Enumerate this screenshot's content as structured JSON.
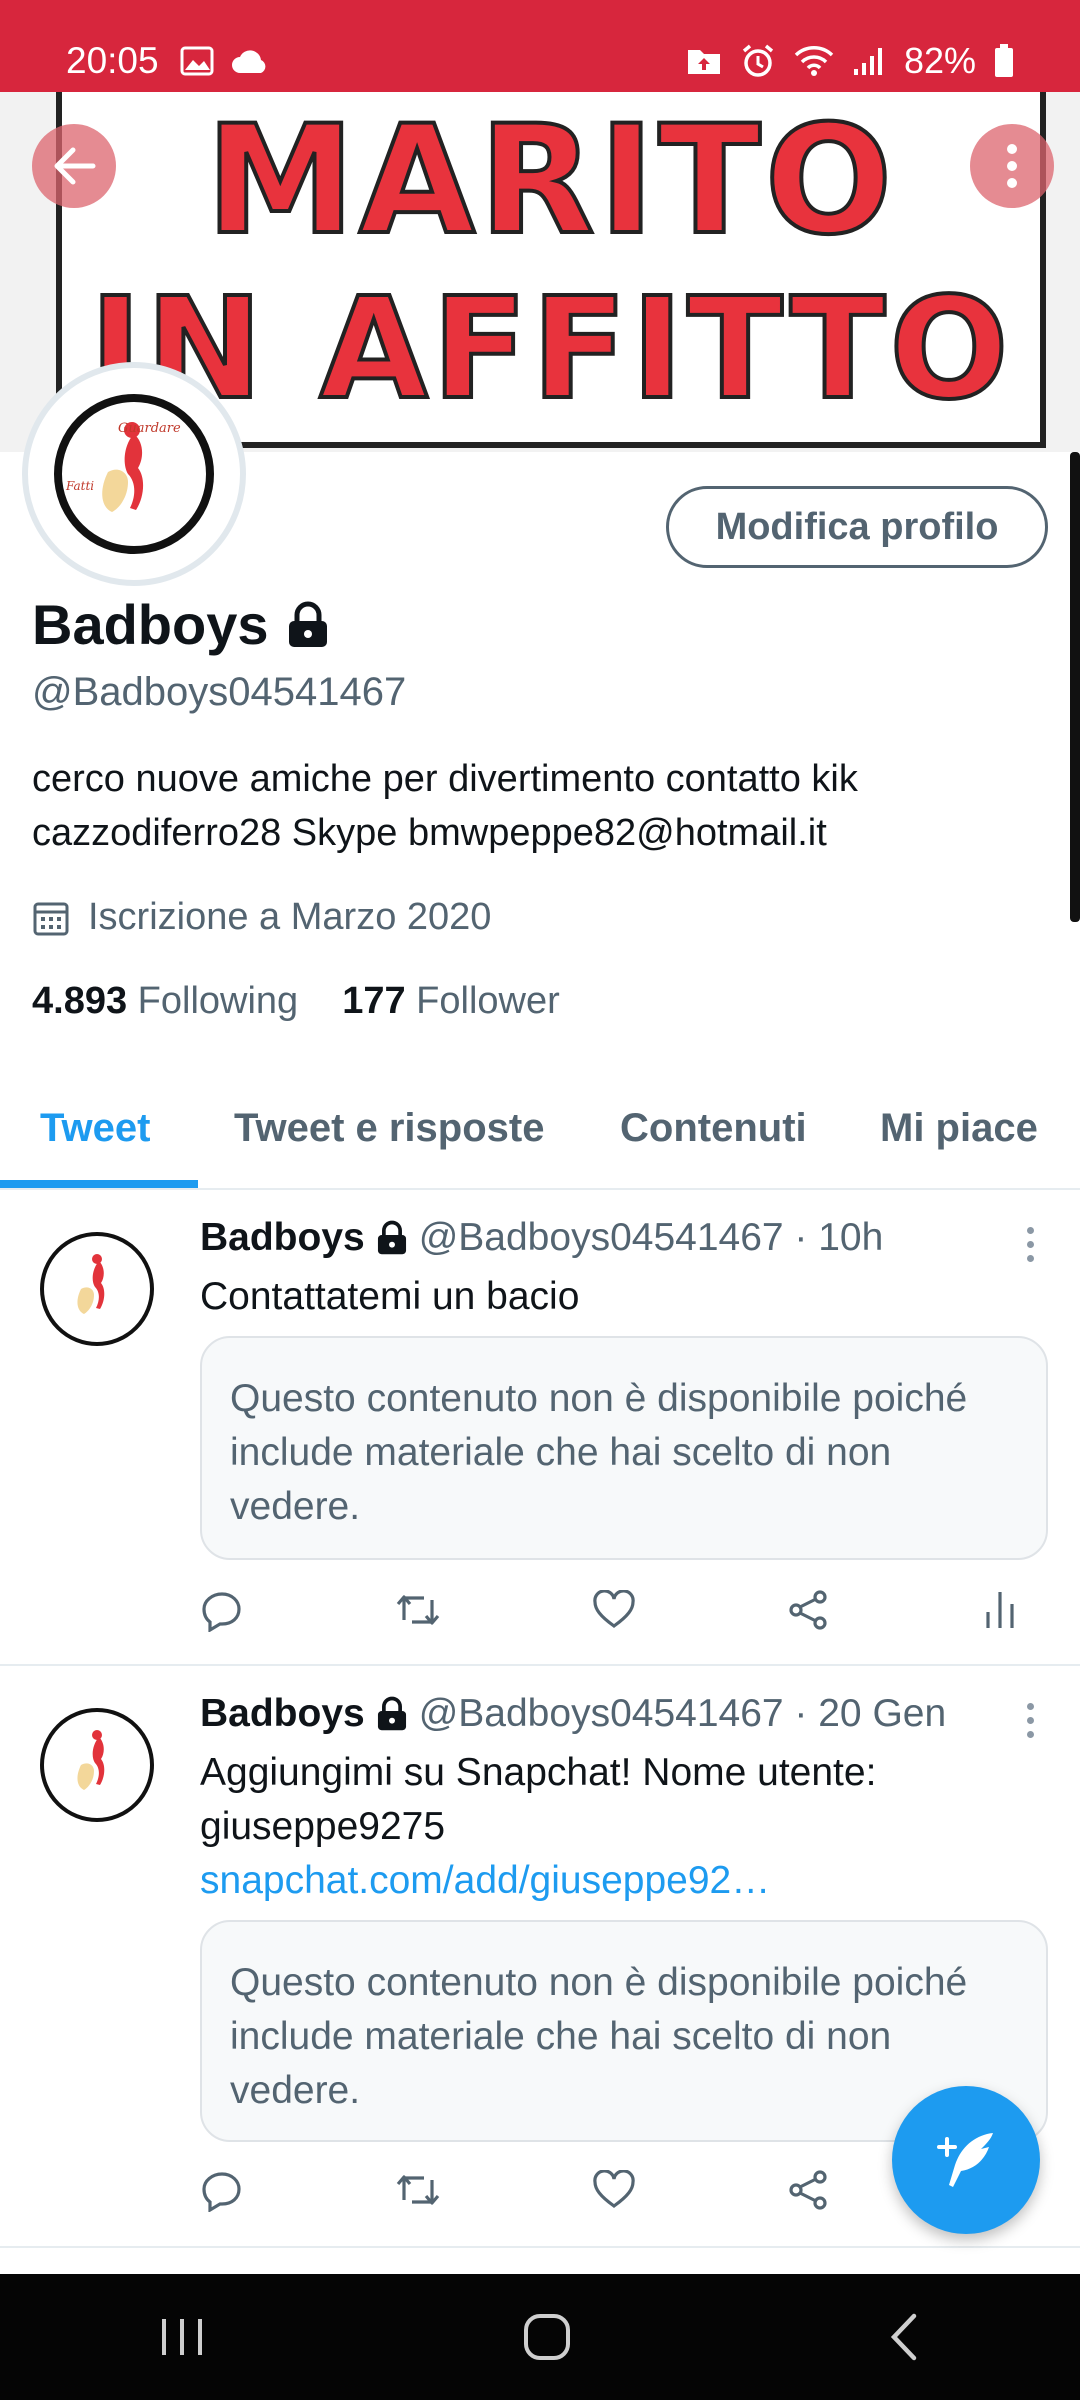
{
  "status_bar": {
    "time": "20:05",
    "battery": "82%",
    "color": "#d7263d"
  },
  "banner": {
    "line1": "MARITO",
    "line2": "IN AFFITTO"
  },
  "avatar": {
    "text_top": "Guardare",
    "text_left": "Fatti"
  },
  "profile": {
    "edit_button": "Modifica profilo",
    "name": "Badboys",
    "handle": "@Badboys04541467",
    "bio": "cerco nuove amiche per divertimento contatto kik cazzodiferro28  Skype bmwpeppe82@hotmail.it",
    "joined": "Iscrizione a Marzo 2020",
    "following_count": "4.893",
    "following_label": "Following",
    "follower_count": "177",
    "follower_label": "Follower"
  },
  "tabs": [
    {
      "label": "Tweet",
      "active": true
    },
    {
      "label": "Tweet e risposte",
      "active": false
    },
    {
      "label": "Contenuti",
      "active": false
    },
    {
      "label": "Mi piace",
      "active": false
    }
  ],
  "tweets": [
    {
      "name": "Badboys",
      "meta": "@Badboys04541467 · 10h",
      "text": "Contattatemi un bacio",
      "link": "",
      "notice": "Questo contenuto non è disponibile poiché include materiale che hai scelto di non vedere."
    },
    {
      "name": "Badboys",
      "meta": "@Badboys04541467 · 20 Gen",
      "text": "Aggiungimi su Snapchat! Nome utente: giuseppe9275 ",
      "link": "snapchat.com/add/giuseppe92…",
      "notice": "Questo contenuto non è disponibile poiché include materiale che hai scelto di non vedere."
    }
  ],
  "icons": {
    "back": "arrow-left-icon",
    "more": "more-vertical-icon",
    "lock": "lock-icon",
    "calendar": "calendar-icon",
    "reply": "reply-icon",
    "retweet": "retweet-icon",
    "like": "heart-icon",
    "share": "share-icon",
    "analytics": "analytics-icon",
    "compose": "compose-tweet-icon"
  },
  "colors": {
    "accent": "#1d9bf0",
    "text_secondary": "#536471"
  }
}
